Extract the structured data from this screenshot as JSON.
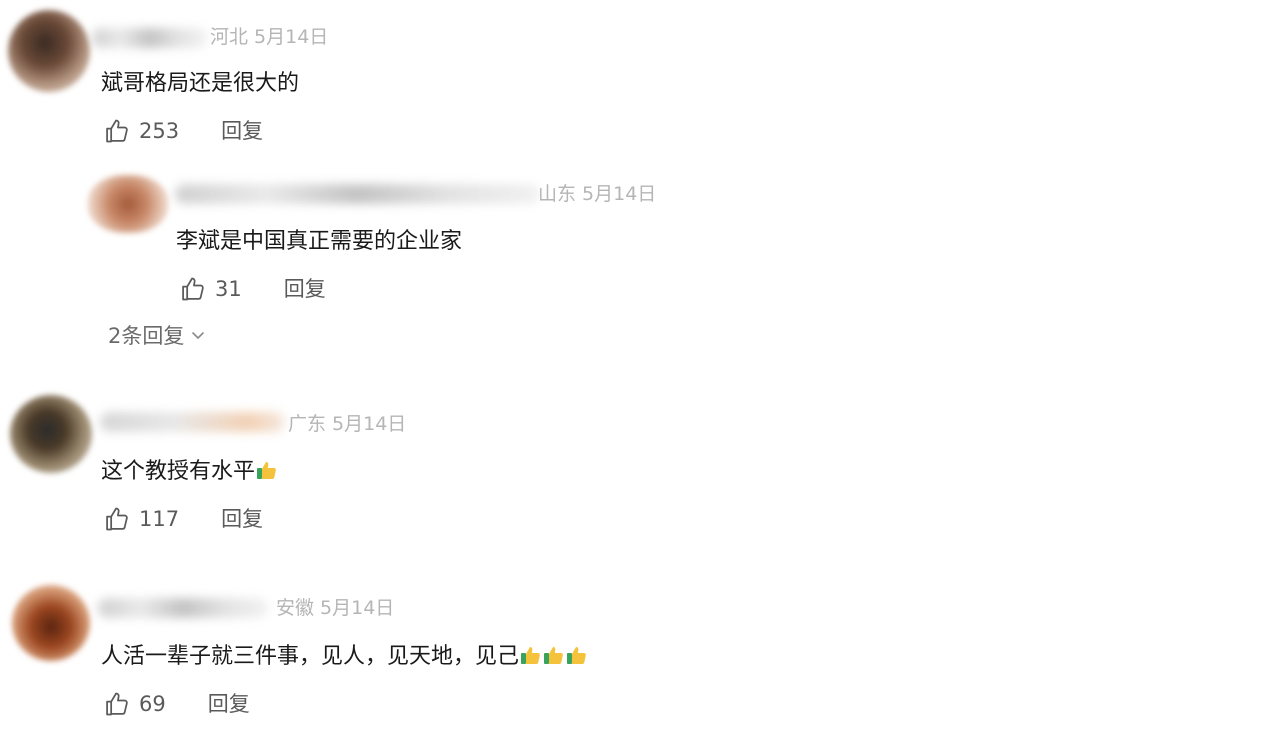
{
  "comments": [
    {
      "location": "河北",
      "date": "5月14日",
      "text": "斌哥格局还是很大的",
      "likes": "253",
      "reply_label": "回复",
      "replies": [
        {
          "location": "山东",
          "date": "5月14日",
          "text": "李斌是中国真正需要的企业家",
          "likes": "31",
          "reply_label": "回复"
        }
      ],
      "more_replies_label": "2条回复"
    },
    {
      "location": "广东",
      "date": "5月14日",
      "text": "这个教授有水平",
      "emoji_count": 1,
      "likes": "117",
      "reply_label": "回复"
    },
    {
      "location": "安徽",
      "date": "5月14日",
      "text": "人活一辈子就三件事，见人，见天地，见己",
      "emoji_count": 3,
      "likes": "69",
      "reply_label": "回复"
    }
  ],
  "icons": {
    "like": "thumbs-up-outline-icon",
    "emoji": "thumbs-up-emoji",
    "expand": "chevron-down-icon"
  },
  "colors": {
    "text": "#1a1a1a",
    "meta": "#b5b5b5",
    "action": "#5a5a5a",
    "emoji_yellow": "#f4c23b",
    "emoji_green": "#3aa35b"
  }
}
